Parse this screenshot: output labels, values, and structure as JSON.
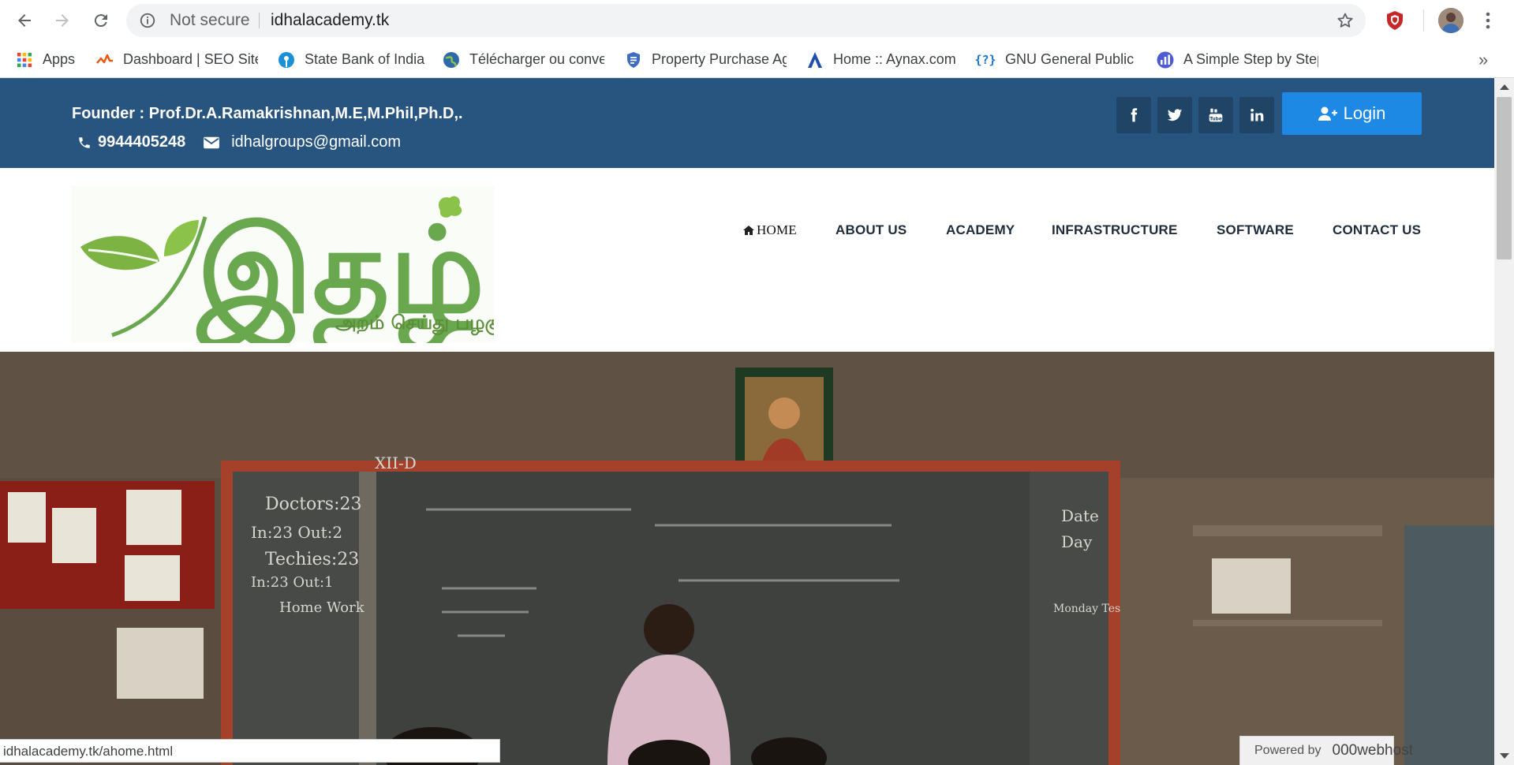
{
  "browser": {
    "omnibox": {
      "security_label": "Not secure",
      "url": "idhalacademy.tk"
    },
    "bookmarks": [
      {
        "label": "Apps",
        "icon": "apps-grid-icon"
      },
      {
        "label": "Dashboard | SEO Site",
        "icon": "seo-dashboard-icon"
      },
      {
        "label": "State Bank of India",
        "icon": "sbi-icon"
      },
      {
        "label": "Télécharger ou conve",
        "icon": "globe-icon"
      },
      {
        "label": "Property Purchase Ag",
        "icon": "shield-doc-icon"
      },
      {
        "label": "Home :: Aynax.com",
        "icon": "aynax-a-icon"
      },
      {
        "label": "GNU General Public L",
        "icon": "gnu-question-icon"
      },
      {
        "label": "A Simple Step by Step",
        "icon": "bar-chart-icon"
      }
    ],
    "overflow_label": "»",
    "status_url": "idhalacademy.tk/ahome.html"
  },
  "site": {
    "topbar": {
      "founder": "Founder : Prof.Dr.A.Ramakrishnan,M.E,M.Phil,Ph.D,.",
      "phone": "9944405248",
      "email": "idhalgroups@gmail.com",
      "login_label": "Login",
      "social": [
        "facebook-icon",
        "twitter-icon",
        "youtube-icon",
        "linkedin-icon"
      ]
    },
    "logo": {
      "title_tamil": "இதழ்",
      "tagline_tamil": "அறம் செய்து பழகு"
    },
    "menu": [
      "HOME",
      "ABOUT US",
      "ACADEMY",
      "INFRASTRUCTURE",
      "SOFTWARE",
      "CONTACT US"
    ],
    "hero": {
      "board_left": [
        "Doctors:23",
        "In:23 Out:2",
        "Techies:23",
        "In:23 Out:1",
        "Home Work"
      ],
      "board_right": [
        "Date",
        "Day",
        "Monday Test"
      ],
      "class_label": "XII-D"
    },
    "powered_by": {
      "prefix": "Powered by",
      "brand": "000webhost"
    }
  },
  "colors": {
    "topbar_bg": "#28557f",
    "social_bg": "#1f4466",
    "login_bg": "#1e88e5",
    "logo_green": "#6aa84f",
    "menu_text": "#1e2b3a"
  }
}
